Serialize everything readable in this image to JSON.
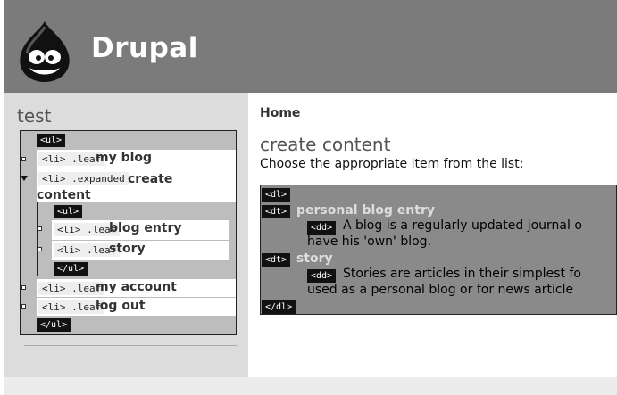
{
  "header": {
    "site_name": "Drupal"
  },
  "sidebar": {
    "block_title": "test",
    "tags": {
      "ul_open": "<ul>",
      "ul_close": "</ul>",
      "li_leaf": "<li> .leaf",
      "li_expanded": "<li> .expanded"
    },
    "items": [
      {
        "label": "my blog"
      },
      {
        "label": "create content"
      },
      {
        "label": "my account"
      },
      {
        "label": "log out"
      }
    ],
    "sub_items": [
      {
        "label": "blog entry"
      },
      {
        "label": "story"
      }
    ]
  },
  "main": {
    "breadcrumb": "Home",
    "title": "create content",
    "help": "Choose the appropriate item from the list:",
    "tags": {
      "dl_open": "<dl>",
      "dl_close": "</dl>",
      "dt": "<dt>",
      "dd": "<dd>"
    },
    "entries": [
      {
        "term": "personal blog entry",
        "desc_line1": "A blog is a regularly updated journal o",
        "desc_line2": "have his 'own' blog."
      },
      {
        "term": "story",
        "desc_line1": "Stories are articles in their simplest fo",
        "desc_line2": "used as a personal blog or for news article"
      }
    ]
  }
}
